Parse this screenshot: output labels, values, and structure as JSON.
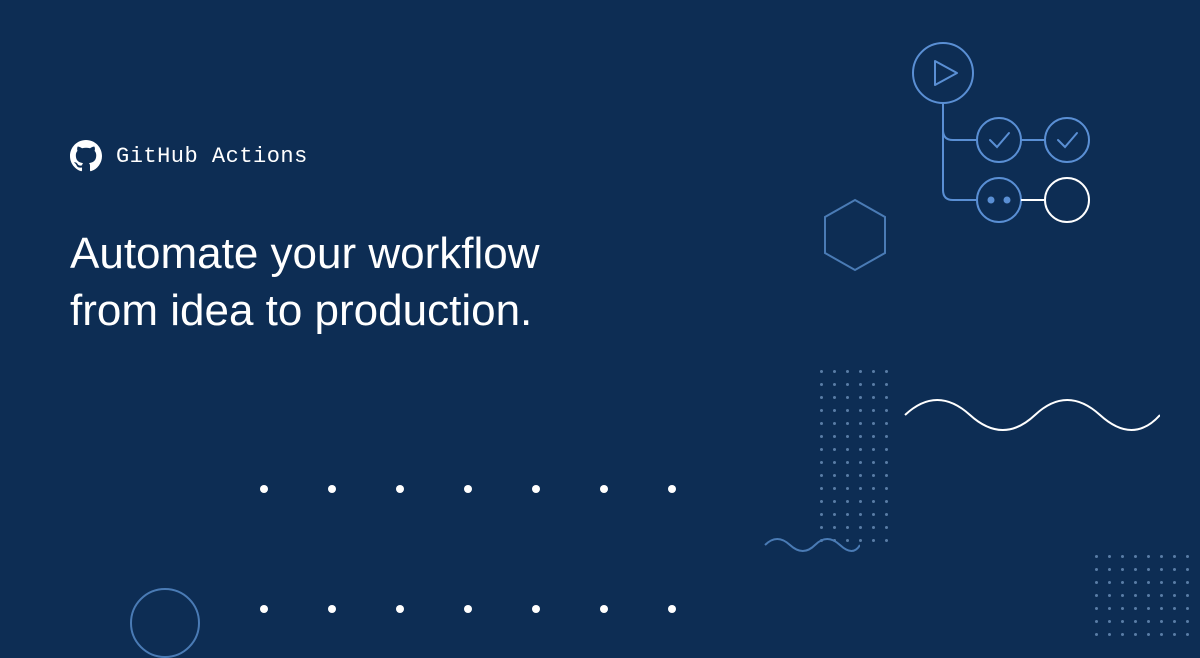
{
  "brand": {
    "name": "GitHub Actions"
  },
  "headline": {
    "line1": "Automate your workflow",
    "line2": "from idea to production."
  },
  "colors": {
    "background": "#0d2d54",
    "accent_light": "#5a8fd4",
    "accent_mid": "#4a7bb5",
    "white": "#ffffff"
  }
}
